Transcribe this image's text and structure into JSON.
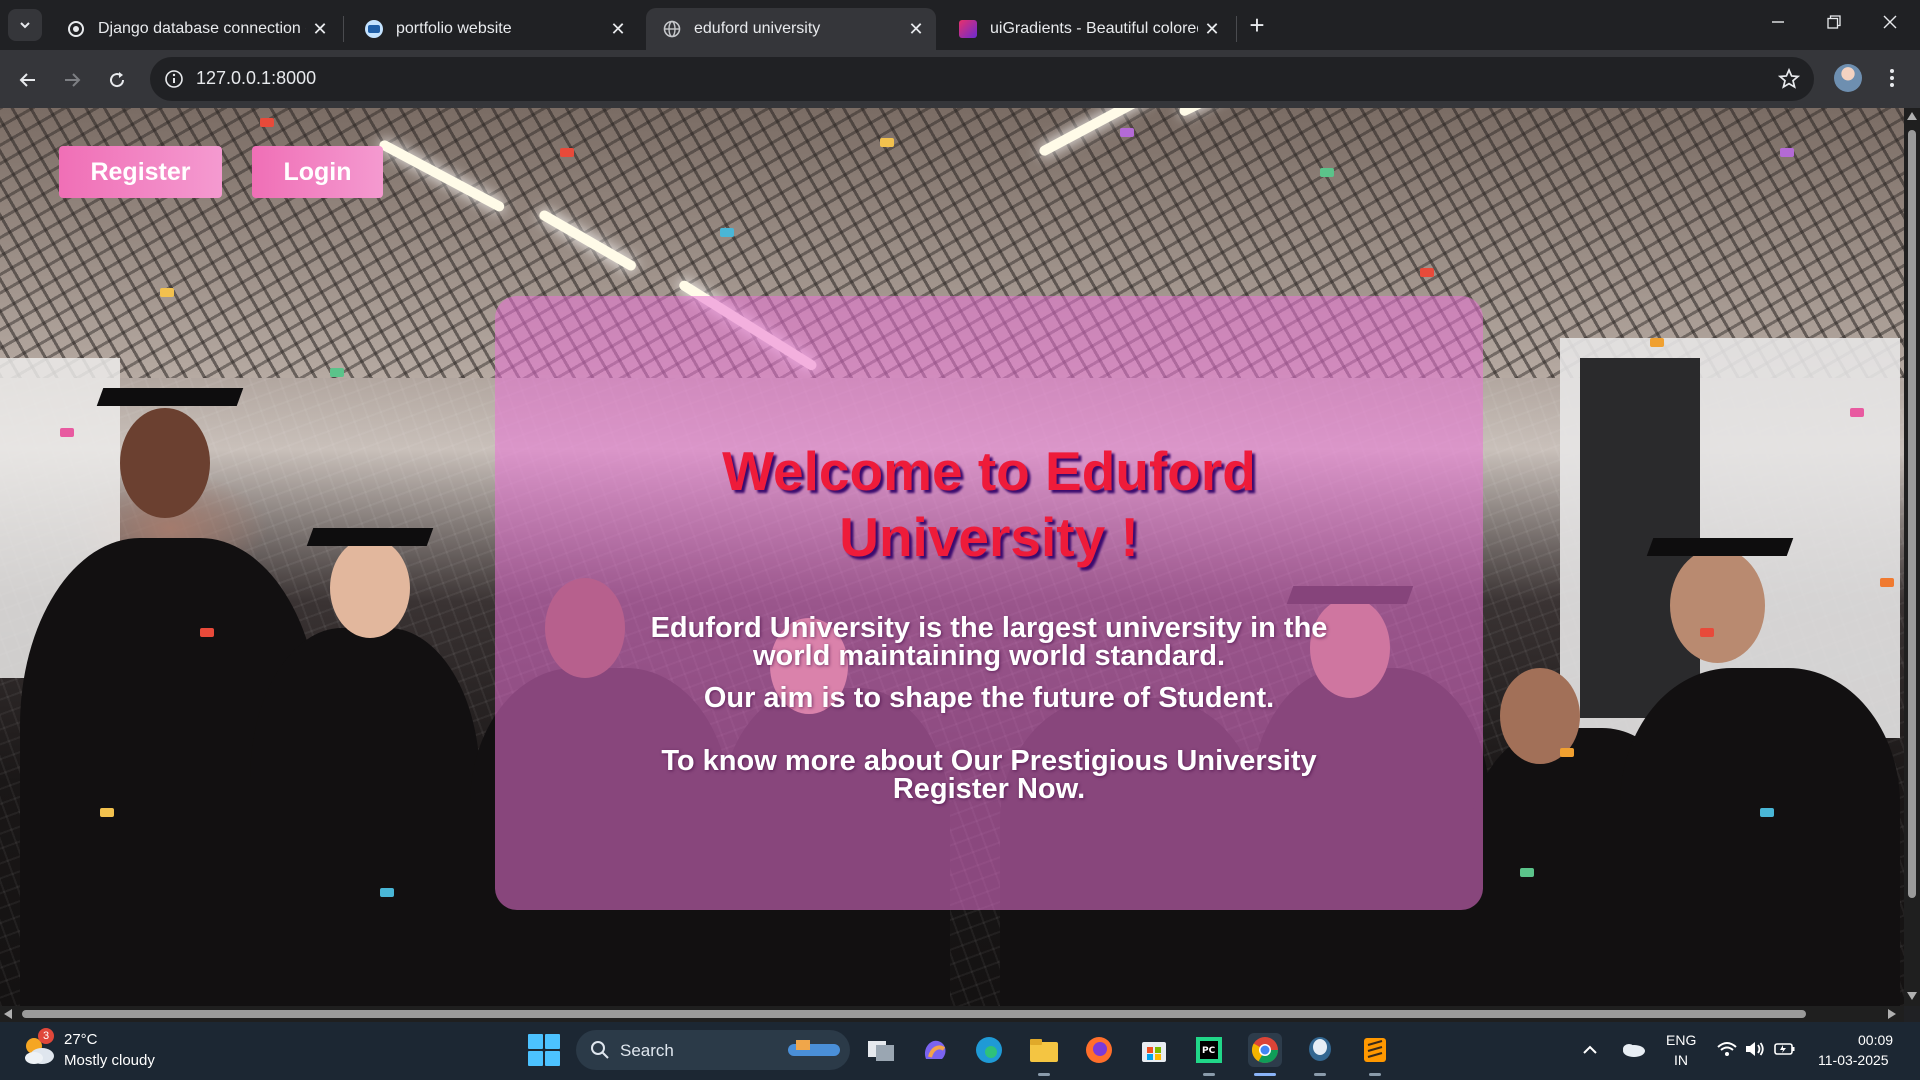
{
  "browser": {
    "tabs": [
      {
        "title": "Django database connection er",
        "favicon": "chatgpt-icon",
        "active": false
      },
      {
        "title": "portfolio website",
        "favicon": "site-icon",
        "active": false
      },
      {
        "title": "eduford university",
        "favicon": "globe-icon",
        "active": true
      },
      {
        "title": "uiGradients - Beautiful colored",
        "favicon": "uigradients-icon",
        "active": false
      }
    ],
    "new_tab_label": "+",
    "url": "127.0.0.1:8000"
  },
  "page": {
    "nav": {
      "register_label": "Register",
      "login_label": "Login"
    },
    "hero": {
      "heading_line1": "Welcome to Eduford",
      "heading_line2": "University !",
      "para1_line1": "Eduford University is the largest university in the",
      "para1_line2": "world maintaining world standard.",
      "para2": "Our aim is to shape the future of Student.",
      "para3_line1": "To know more about Our Prestigious University",
      "para3_line2": "Register Now."
    },
    "colors": {
      "button": "#f06fb6",
      "heading": "#ee1b3a",
      "card_overlay": "#e973d6"
    }
  },
  "taskbar": {
    "weather": {
      "temp": "27°C",
      "desc": "Mostly cloudy",
      "badge": "3"
    },
    "search_label": "Search",
    "language": {
      "line1": "ENG",
      "line2": "IN"
    },
    "clock": {
      "time": "00:09",
      "date": "11-03-2025"
    }
  }
}
